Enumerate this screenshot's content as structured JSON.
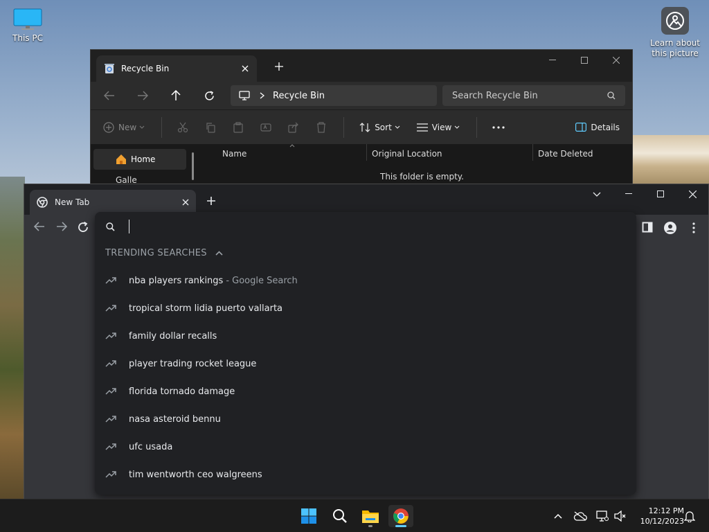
{
  "desktop": {
    "this_pc_label": "This PC",
    "learn_label_line1": "Learn about",
    "learn_label_line2": "this picture"
  },
  "explorer": {
    "tab_title": "Recycle Bin",
    "address": "Recycle Bin",
    "search_placeholder": "Search Recycle Bin",
    "toolbar": {
      "new_label": "New",
      "sort_label": "Sort",
      "view_label": "View",
      "details_label": "Details"
    },
    "sidebar": {
      "home_label": "Home",
      "gallery_label": "Galle"
    },
    "columns": [
      "Name",
      "Original Location",
      "Date Deleted"
    ],
    "empty_message": "This folder is empty."
  },
  "chrome": {
    "tab_title": "New Tab",
    "omnibox_value": "",
    "trending_header": "TRENDING SEARCHES",
    "suggestions": [
      {
        "text": "nba players rankings",
        "suffix": "- Google Search"
      },
      {
        "text": "tropical storm lidia puerto vallarta",
        "suffix": ""
      },
      {
        "text": "family dollar recalls",
        "suffix": ""
      },
      {
        "text": "player trading rocket league",
        "suffix": ""
      },
      {
        "text": "florida tornado damage",
        "suffix": ""
      },
      {
        "text": "nasa asteroid bennu",
        "suffix": ""
      },
      {
        "text": "ufc usada",
        "suffix": ""
      },
      {
        "text": "tim wentworth ceo walgreens",
        "suffix": ""
      }
    ]
  },
  "taskbar": {
    "time": "12:12 PM",
    "date": "10/12/2023",
    "pinned": [
      "start-icon",
      "search-icon",
      "file-explorer-icon",
      "chrome-icon"
    ]
  },
  "colors": {
    "explorer_bg": "#202020",
    "chrome_dropdown_bg": "#202124",
    "accent_blue": "#60cdff"
  }
}
